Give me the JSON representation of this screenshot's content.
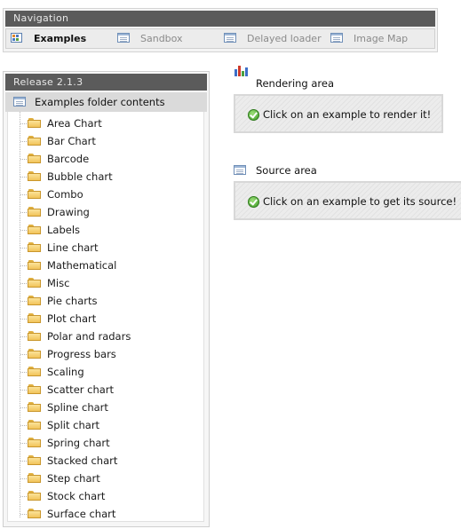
{
  "navigation": {
    "title": "Navigation",
    "tabs": [
      {
        "label": "Examples",
        "icon": "grid-icon",
        "active": true
      },
      {
        "label": "Sandbox",
        "icon": "document-icon",
        "active": false
      },
      {
        "label": "Delayed loader",
        "icon": "document-icon",
        "active": false
      },
      {
        "label": "Image Map",
        "icon": "document-icon",
        "active": false
      }
    ]
  },
  "release": {
    "title": "Release 2.1.3",
    "root_label": "Examples folder contents",
    "folders": [
      "Area Chart",
      "Bar Chart",
      "Barcode",
      "Bubble chart",
      "Combo",
      "Drawing",
      "Labels",
      "Line chart",
      "Mathematical",
      "Misc",
      "Pie charts",
      "Plot chart",
      "Polar and radars",
      "Progress bars",
      "Scaling",
      "Scatter chart",
      "Spline chart",
      "Split chart",
      "Spring chart",
      "Stacked chart",
      "Step chart",
      "Stock chart",
      "Surface chart"
    ]
  },
  "rendering": {
    "title": "Rendering area",
    "message": "Click on an example to render it!",
    "icon": "bar-chart-icon"
  },
  "source": {
    "title": "Source area",
    "message": "Click on an example to get its source!",
    "icon": "document-icon"
  },
  "colors": {
    "header_bg": "#5b5b5b",
    "ok_green": "#3d9a26",
    "folder_yellow": "#f2c45a"
  }
}
